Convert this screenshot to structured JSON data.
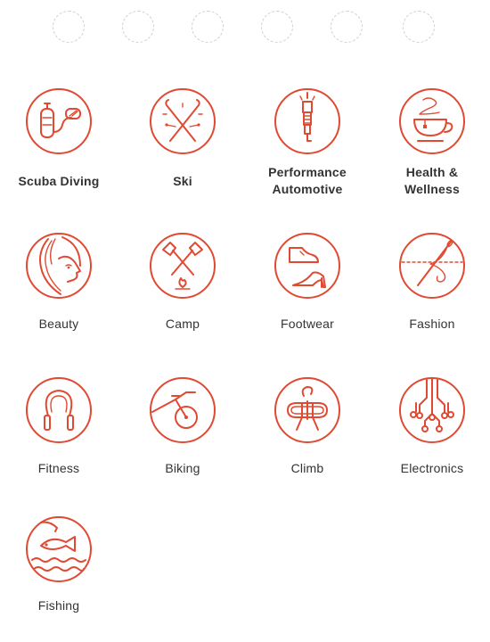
{
  "accent_color": "#e04a32",
  "placeholder_count": 6,
  "categories": [
    {
      "label": "Scuba Diving",
      "icon": "scuba-tank-icon"
    },
    {
      "label": "Ski",
      "icon": "skis-icon"
    },
    {
      "label": "Performance\nAutomotive",
      "icon": "spark-plug-icon"
    },
    {
      "label": "Health &\nWellness",
      "icon": "tea-cup-icon"
    },
    {
      "label": "Beauty",
      "icon": "woman-face-icon"
    },
    {
      "label": "Camp",
      "icon": "axes-campfire-icon"
    },
    {
      "label": "Footwear",
      "icon": "shoes-icon"
    },
    {
      "label": "Fashion",
      "icon": "needle-thread-icon"
    },
    {
      "label": "Fitness",
      "icon": "jump-rope-icon"
    },
    {
      "label": "Biking",
      "icon": "bicycle-icon"
    },
    {
      "label": "Climb",
      "icon": "climbing-rope-icon"
    },
    {
      "label": "Electronics",
      "icon": "circuit-icon"
    },
    {
      "label": "Fishing",
      "icon": "fish-icon"
    }
  ]
}
